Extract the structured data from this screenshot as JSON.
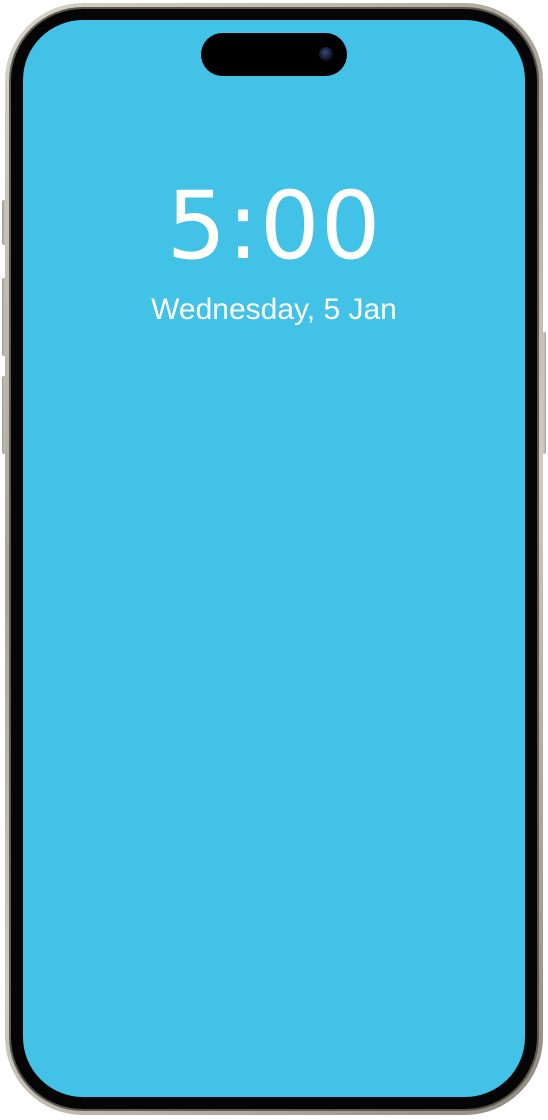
{
  "lock_screen": {
    "time": "5:00",
    "date": "Wednesday, 5 Jan"
  },
  "colors": {
    "wallpaper": "#42c2e6",
    "text": "#ffffff",
    "frame": "#c9c4ba",
    "bezel": "#050505"
  },
  "icons": {
    "front_camera": "front-camera-icon"
  }
}
